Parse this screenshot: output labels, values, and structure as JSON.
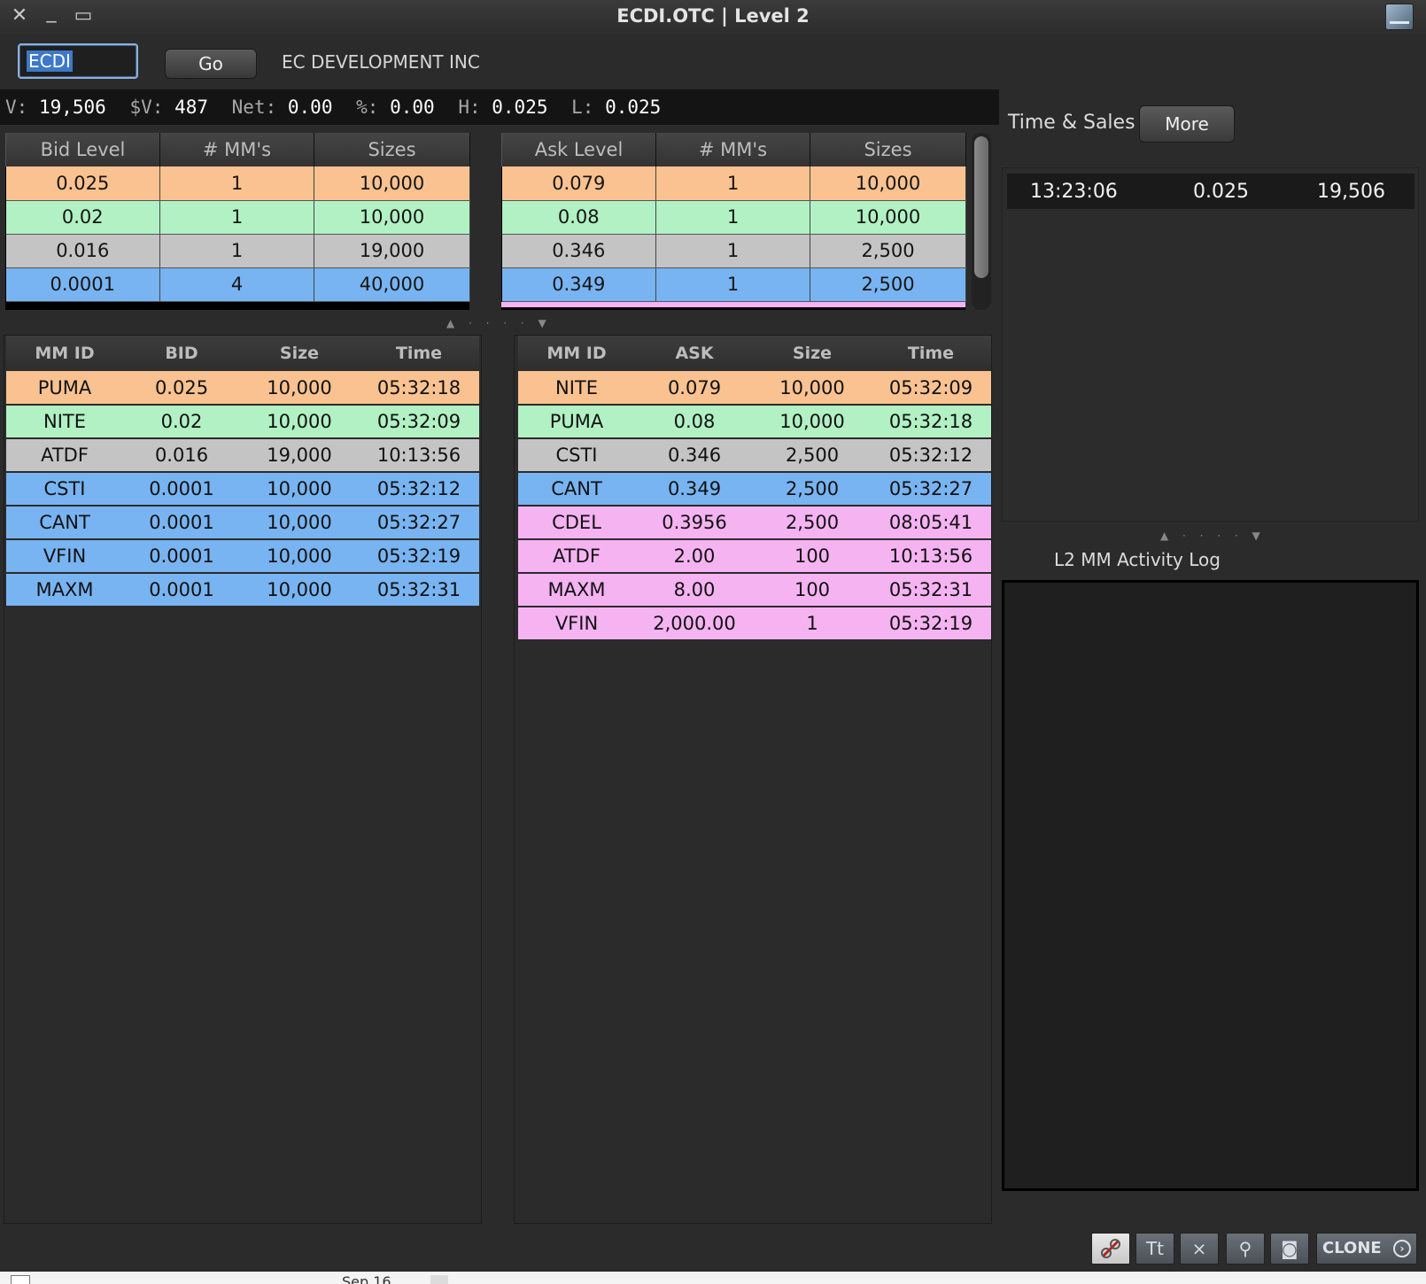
{
  "window": {
    "title": "ECDI.OTC | Level 2",
    "close_glyph": "✕",
    "minimize_glyph": "_",
    "maximize_glyph": "▭",
    "icon": "app-window-icon"
  },
  "symbol_bar": {
    "symbol_value": "ECDI",
    "go_label": "Go",
    "company_name": "EC DEVELOPMENT INC"
  },
  "stats": {
    "v_label": "V:",
    "v_value": "19,506",
    "dv_label": "$V:",
    "dv_value": "487",
    "net_label": "Net:",
    "net_value": "0.00",
    "pct_label": "%:",
    "pct_value": "0.00",
    "h_label": "H:",
    "h_value": "0.025",
    "l_label": "L:",
    "l_value": "0.025"
  },
  "bid_levels": {
    "headers": [
      "Bid Level",
      "# MM's",
      "Sizes"
    ],
    "rows": [
      {
        "level": "0.025",
        "mms": "1",
        "size": "10,000",
        "color": "orange"
      },
      {
        "level": "0.02",
        "mms": "1",
        "size": "10,000",
        "color": "green"
      },
      {
        "level": "0.016",
        "mms": "1",
        "size": "19,000",
        "color": "gray"
      },
      {
        "level": "0.0001",
        "mms": "4",
        "size": "40,000",
        "color": "blue"
      }
    ]
  },
  "ask_levels": {
    "headers": [
      "Ask Level",
      "# MM's",
      "Sizes"
    ],
    "rows": [
      {
        "level": "0.079",
        "mms": "1",
        "size": "10,000",
        "color": "orange"
      },
      {
        "level": "0.08",
        "mms": "1",
        "size": "10,000",
        "color": "green"
      },
      {
        "level": "0.346",
        "mms": "1",
        "size": "2,500",
        "color": "gray"
      },
      {
        "level": "0.349",
        "mms": "1",
        "size": "2,500",
        "color": "blue"
      }
    ]
  },
  "bid_mm": {
    "headers": [
      "MM ID",
      "BID",
      "Size",
      "Time"
    ],
    "rows": [
      {
        "id": "PUMA",
        "price": "0.025",
        "size": "10,000",
        "time": "05:32:18",
        "color": "orange"
      },
      {
        "id": "NITE",
        "price": "0.02",
        "size": "10,000",
        "time": "05:32:09",
        "color": "green"
      },
      {
        "id": "ATDF",
        "price": "0.016",
        "size": "19,000",
        "time": "10:13:56",
        "color": "gray"
      },
      {
        "id": "CSTI",
        "price": "0.0001",
        "size": "10,000",
        "time": "05:32:12",
        "color": "blue"
      },
      {
        "id": "CANT",
        "price": "0.0001",
        "size": "10,000",
        "time": "05:32:27",
        "color": "blue"
      },
      {
        "id": "VFIN",
        "price": "0.0001",
        "size": "10,000",
        "time": "05:32:19",
        "color": "blue"
      },
      {
        "id": "MAXM",
        "price": "0.0001",
        "size": "10,000",
        "time": "05:32:31",
        "color": "blue"
      }
    ]
  },
  "ask_mm": {
    "headers": [
      "MM ID",
      "ASK",
      "Size",
      "Time"
    ],
    "rows": [
      {
        "id": "NITE",
        "price": "0.079",
        "size": "10,000",
        "time": "05:32:09",
        "color": "orange"
      },
      {
        "id": "PUMA",
        "price": "0.08",
        "size": "10,000",
        "time": "05:32:18",
        "color": "green"
      },
      {
        "id": "CSTI",
        "price": "0.346",
        "size": "2,500",
        "time": "05:32:12",
        "color": "gray"
      },
      {
        "id": "CANT",
        "price": "0.349",
        "size": "2,500",
        "time": "05:32:27",
        "color": "blue"
      },
      {
        "id": "CDEL",
        "price": "0.3956",
        "size": "2,500",
        "time": "08:05:41",
        "color": "pink"
      },
      {
        "id": "ATDF",
        "price": "2.00",
        "size": "100",
        "time": "10:13:56",
        "color": "pink"
      },
      {
        "id": "MAXM",
        "price": "8.00",
        "size": "100",
        "time": "05:32:31",
        "color": "pink"
      },
      {
        "id": "VFIN",
        "price": "2,000.00",
        "size": "1",
        "time": "05:32:19",
        "color": "pink"
      }
    ]
  },
  "time_sales": {
    "label": "Time & Sales",
    "more_label": "More",
    "rows": [
      {
        "time": "13:23:06",
        "price": "0.025",
        "size": "19,506"
      }
    ]
  },
  "activity_log": {
    "label": "L2 MM Activity Log"
  },
  "toolbar": {
    "link_icon": "link-icon",
    "font_label": "Tt",
    "clone_label": "CLONE",
    "clone_arrow": "›"
  },
  "taskbar": {
    "date_text": "Sep 16"
  },
  "colors": {
    "orange": "#f9c290",
    "green": "#b1f1c4",
    "gray": "#c4c4c4",
    "blue": "#78b4f1",
    "pink": "#f5b3f2"
  }
}
